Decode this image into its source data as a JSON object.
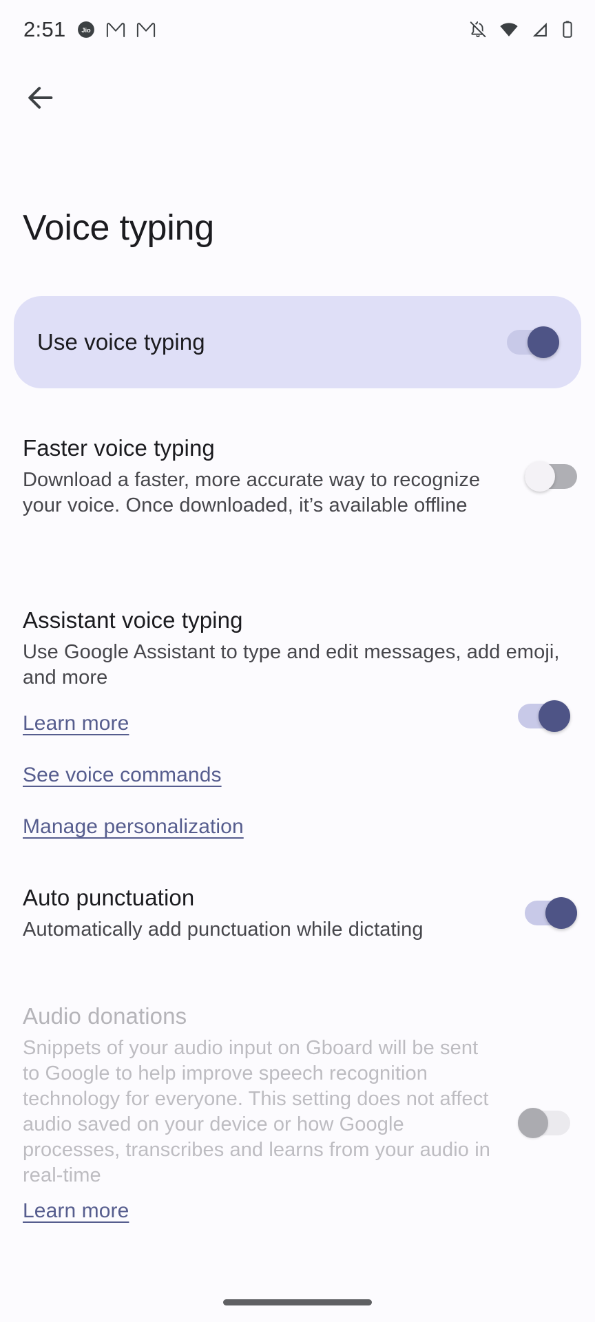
{
  "status_bar": {
    "time": "2:51",
    "left_icons": [
      "jio-icon",
      "gmail-icon",
      "gmail-icon"
    ],
    "right_icons": [
      "notifications-off-icon",
      "wifi-icon",
      "cellular-signal-icon",
      "battery-icon"
    ]
  },
  "app_bar": {
    "back_icon": "back-arrow-icon"
  },
  "page": {
    "title": "Voice typing"
  },
  "highlighted_setting": {
    "label": "Use voice typing",
    "toggle_state": "on"
  },
  "settings": [
    {
      "title": "Faster voice typing",
      "subtitle": "Download a faster, more accurate way to recognize your voice. Once downloaded, it’s available offline",
      "toggle_state": "off",
      "enabled": true
    },
    {
      "title": "Assistant voice typing",
      "subtitle": "Use Google Assistant to type and edit messages, add emoji, and more",
      "toggle_state": "on",
      "enabled": true
    },
    {
      "title": "Auto punctuation",
      "subtitle": "Automatically add punctuation while dictating",
      "toggle_state": "on",
      "enabled": true
    },
    {
      "title": "Audio donations",
      "subtitle": "Snippets of your audio input on Gboard will be sent to Google to help improve speech recognition technology for everyone. This setting does not affect audio saved on your device or how Google processes, transcribes and learns from your audio in real-time",
      "toggle_state": "off",
      "enabled": false
    }
  ],
  "links": {
    "assistant_learn_more": "Learn more",
    "see_voice_commands": "See voice commands",
    "manage_personalization": "Manage personalization",
    "audio_learn_more": "Learn more"
  },
  "colors": {
    "background": "#FCFBFE",
    "card_highlight": "#DFDFF7",
    "toggle_on_thumb": "#4E5486",
    "toggle_on_track": "#C8C9E8",
    "toggle_off_track": "#AFAFB4",
    "link": "#565D8E",
    "text_primary": "#1B1B1F",
    "text_secondary": "#46464B",
    "text_disabled": "#B5B4B9"
  }
}
